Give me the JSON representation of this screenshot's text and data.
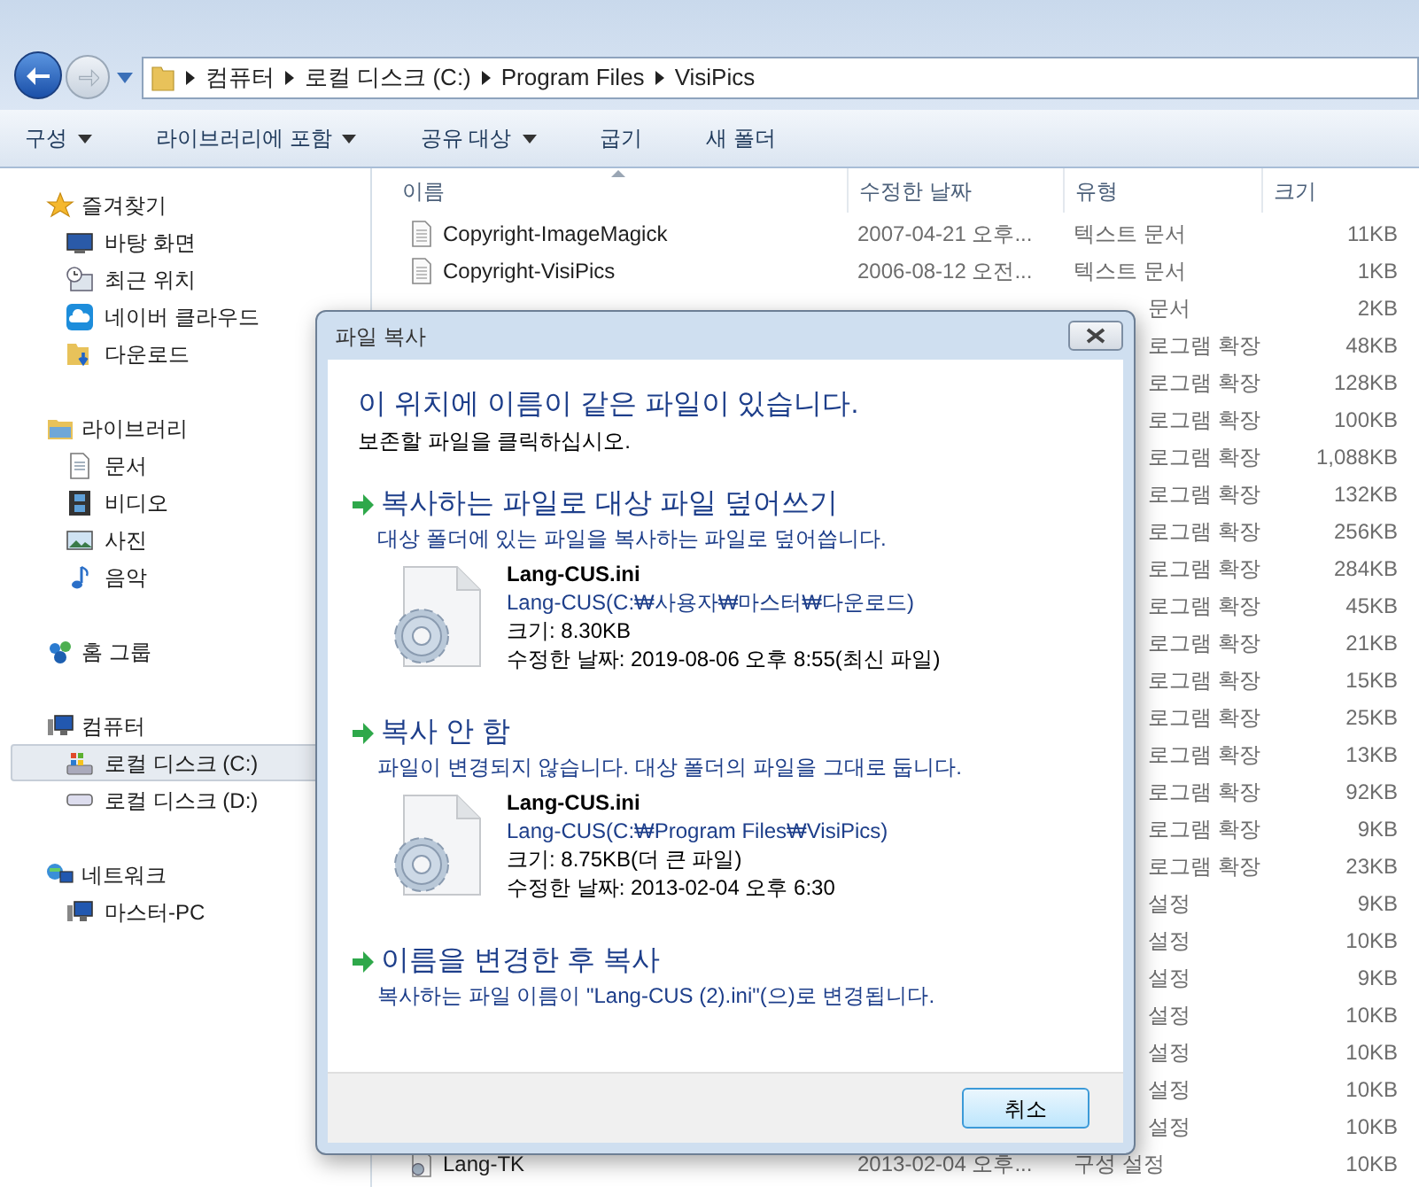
{
  "address_bar": {
    "crumbs": [
      "컴퓨터",
      "로컬 디스크 (C:)",
      "Program Files",
      "VisiPics"
    ]
  },
  "toolbar": [
    {
      "label": "구성",
      "dropdown": true
    },
    {
      "label": "라이브러리에 포함",
      "dropdown": true
    },
    {
      "label": "공유 대상",
      "dropdown": true
    },
    {
      "label": "굽기",
      "dropdown": false
    },
    {
      "label": "새 폴더",
      "dropdown": false
    }
  ],
  "sidebar": [
    {
      "label": "즐겨찾기",
      "kind": "star",
      "children": [
        {
          "label": "바탕 화면",
          "kind": "desktop",
          "selected": false
        },
        {
          "label": "최근 위치",
          "kind": "recent",
          "selected": false
        },
        {
          "label": "네이버 클라우드",
          "kind": "cloud",
          "selected": false
        },
        {
          "label": "다운로드",
          "kind": "download",
          "selected": false
        }
      ]
    },
    {
      "label": "라이브러리",
      "kind": "library",
      "children": [
        {
          "label": "문서",
          "kind": "document",
          "selected": false
        },
        {
          "label": "비디오",
          "kind": "video",
          "selected": false
        },
        {
          "label": "사진",
          "kind": "picture",
          "selected": false
        },
        {
          "label": "음악",
          "kind": "music",
          "selected": false
        }
      ]
    },
    {
      "label": "홈 그룹",
      "kind": "homegroup"
    },
    {
      "label": "컴퓨터",
      "kind": "computer",
      "children": [
        {
          "label": "로컬 디스크 (C:)",
          "kind": "windisk",
          "selected": true
        },
        {
          "label": "로컬 디스크 (D:)",
          "kind": "disk",
          "selected": false
        }
      ]
    },
    {
      "label": "네트워크",
      "kind": "network",
      "children": [
        {
          "label": "마스터-PC",
          "kind": "computer",
          "selected": false
        }
      ]
    }
  ],
  "file_list": {
    "columns": [
      "이름",
      "수정한 날짜",
      "유형",
      "크기"
    ],
    "rows": [
      {
        "name": "Copyright-ImageMagick",
        "modified": "2007-04-21 오후...",
        "type": "텍스트 문서",
        "size": "11KB",
        "kind": "text"
      },
      {
        "name": "Copyright-VisiPics",
        "modified": "2006-08-12 오전...",
        "type": "텍스트 문서",
        "size": "1KB",
        "kind": "text"
      },
      {
        "type": "문서",
        "size": "2KB"
      },
      {
        "type": "로그램 확장",
        "size": "48KB"
      },
      {
        "type": "로그램 확장",
        "size": "128KB"
      },
      {
        "type": "로그램 확장",
        "size": "100KB"
      },
      {
        "type": "로그램 확장",
        "size": "1,088KB"
      },
      {
        "type": "로그램 확장",
        "size": "132KB"
      },
      {
        "type": "로그램 확장",
        "size": "256KB"
      },
      {
        "type": "로그램 확장",
        "size": "284KB"
      },
      {
        "type": "로그램 확장",
        "size": "45KB"
      },
      {
        "type": "로그램 확장",
        "size": "21KB"
      },
      {
        "type": "로그램 확장",
        "size": "15KB"
      },
      {
        "type": "로그램 확장",
        "size": "25KB"
      },
      {
        "type": "로그램 확장",
        "size": "13KB"
      },
      {
        "type": "로그램 확장",
        "size": "92KB"
      },
      {
        "type": "로그램 확장",
        "size": "9KB"
      },
      {
        "type": "로그램 확장",
        "size": "23KB"
      },
      {
        "type": "설정",
        "size": "9KB"
      },
      {
        "type": "설정",
        "size": "10KB"
      },
      {
        "type": "설정",
        "size": "9KB"
      },
      {
        "type": "설정",
        "size": "10KB"
      },
      {
        "type": "설정",
        "size": "10KB"
      },
      {
        "type": "설정",
        "size": "10KB"
      },
      {
        "type": "설정",
        "size": "10KB"
      },
      {
        "name": "Lang-TK",
        "modified": "2013-02-04 오후...",
        "type": "구성 설정",
        "size": "10KB",
        "kind": "config"
      }
    ]
  },
  "dialog": {
    "title": "파일 복사",
    "heading": "이 위치에 이름이 같은 파일이 있습니다.",
    "subheading": "보존할 파일을 클릭하십시오.",
    "options": [
      {
        "title": "복사하는 파일로 대상 파일 덮어쓰기",
        "description": "대상 폴더에 있는 파일을 복사하는 파일로 덮어씁니다.",
        "file": {
          "name": "Lang-CUS.ini",
          "path": "Lang-CUS(C:₩사용자₩마스터₩다운로드)",
          "size": "크기: 8.30KB",
          "modified": "수정한 날짜: 2019-08-06 오후 8:55(최신 파일)"
        }
      },
      {
        "title": "복사 안 함",
        "description": "파일이 변경되지 않습니다. 대상 폴더의 파일을 그대로 둡니다.",
        "file": {
          "name": "Lang-CUS.ini",
          "path": "Lang-CUS(C:₩Program Files₩VisiPics)",
          "size": "크기: 8.75KB(더 큰 파일)",
          "modified": "수정한 날짜: 2013-02-04 오후 6:30"
        }
      },
      {
        "title": "이름을 변경한 후 복사",
        "description": "복사하는 파일 이름이 \"Lang-CUS (2).ini\"(으)로 변경됩니다."
      }
    ],
    "cancel_button": "취소"
  }
}
